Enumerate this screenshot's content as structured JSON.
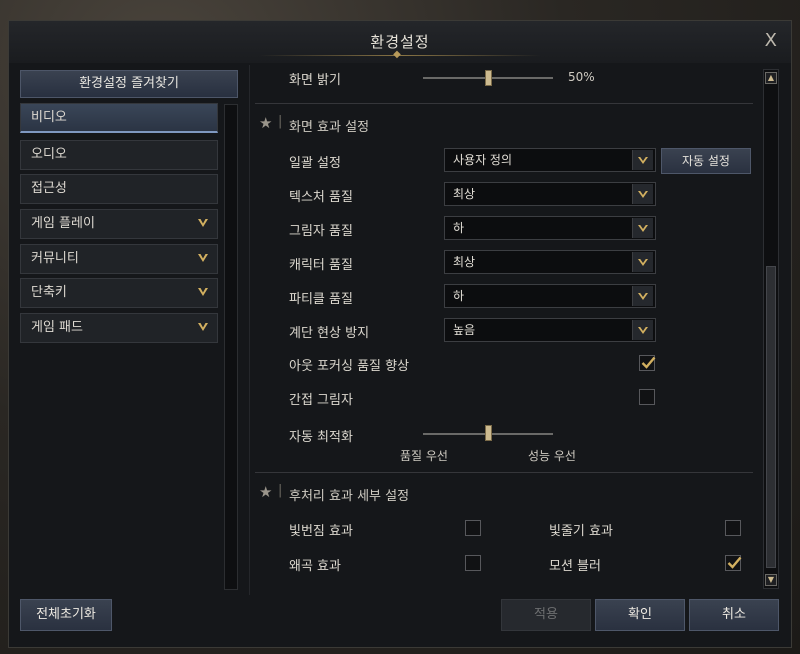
{
  "window": {
    "title": "환경설정",
    "close_label": "X"
  },
  "sidebar": {
    "favorites_label": "환경설정 즐겨찾기",
    "items": [
      {
        "label": "비디오",
        "active": true,
        "expandable": false
      },
      {
        "label": "오디오",
        "active": false,
        "expandable": false
      },
      {
        "label": "접근성",
        "active": false,
        "expandable": false
      },
      {
        "label": "게임 플레이",
        "active": false,
        "expandable": true
      },
      {
        "label": "커뮤니티",
        "active": false,
        "expandable": true
      },
      {
        "label": "단축키",
        "active": false,
        "expandable": true
      },
      {
        "label": "게임 패드",
        "active": false,
        "expandable": true
      }
    ]
  },
  "brightness": {
    "label": "화면 밝기",
    "value": "50%",
    "level": 0.5
  },
  "effects_section": {
    "title": "화면 효과 설정",
    "preset": {
      "label": "일괄 설정",
      "value": "사용자 정의",
      "auto_button": "자동 설정"
    },
    "dropdowns": [
      {
        "label": "텍스처 품질",
        "value": "최상"
      },
      {
        "label": "그림자 품질",
        "value": "하"
      },
      {
        "label": "캐릭터 품질",
        "value": "최상"
      },
      {
        "label": "파티클 품질",
        "value": "하"
      },
      {
        "label": "계단 현상 방지",
        "value": "높음"
      }
    ],
    "checkboxes": [
      {
        "label": "아웃 포커싱 품질 향상",
        "checked": true
      },
      {
        "label": "간접 그림자",
        "checked": false
      }
    ],
    "auto_opt": {
      "label": "자동 최적화",
      "left": "품질 우선",
      "right": "성능 우선",
      "level": 0.5
    }
  },
  "post_section": {
    "title": "후처리 효과 세부 설정",
    "options": [
      {
        "label": "빛번짐 효과",
        "checked": false
      },
      {
        "label": "빛줄기 효과",
        "checked": false
      },
      {
        "label": "왜곡 효과",
        "checked": false
      },
      {
        "label": "모션 블러",
        "checked": true
      }
    ]
  },
  "footer": {
    "reset": "전체초기화",
    "apply": "적용",
    "ok": "확인",
    "cancel": "취소"
  },
  "colors": {
    "accent_gold": "#cdbb90",
    "button_blue": "#2a3140",
    "active_blue": "#7f98c0"
  },
  "icons": {
    "chevron": "chevron-down-icon",
    "star": "star-icon",
    "check": "check-icon"
  }
}
